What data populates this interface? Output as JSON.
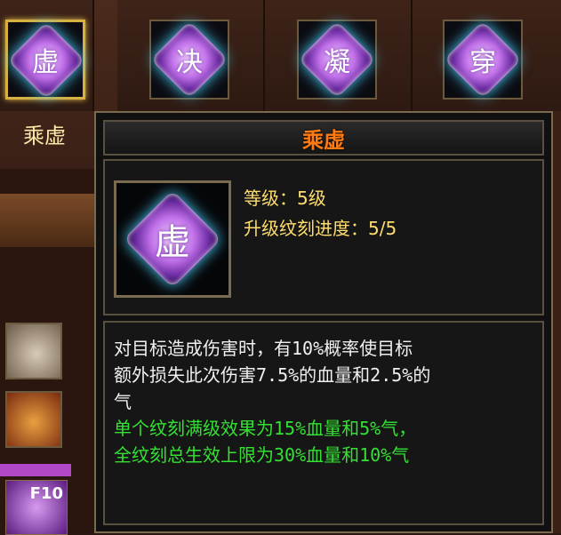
{
  "slots": [
    {
      "char": "虚",
      "selected": true
    },
    {
      "char": "决",
      "selected": false
    },
    {
      "char": "凝",
      "selected": false
    },
    {
      "char": "穿",
      "selected": false
    }
  ],
  "selected_label": "乘虚",
  "side": {
    "hotkey": "F10"
  },
  "tooltip": {
    "title": "乘虚",
    "icon_char": "虚",
    "level_line": "等级：5级",
    "progress_line": "升级纹刻进度：5/5",
    "desc": [
      "对目标造成伤害时，有10%概率使目标",
      "额外损失此次伤害7.5%的血量和2.5%的",
      "气"
    ],
    "bonus": [
      "单个纹刻满级效果为15%血量和5%气，",
      "全纹刻总生效上限为30%血量和10%气"
    ]
  },
  "colors": {
    "title": "#ff7a10",
    "stat": "#ffdd6e",
    "bonus": "#33e033",
    "frame": "#7a6a50"
  },
  "icons": {
    "gem": "rune-gem-icon",
    "horse": "horse-icon",
    "chest": "treasure-chest-icon"
  }
}
